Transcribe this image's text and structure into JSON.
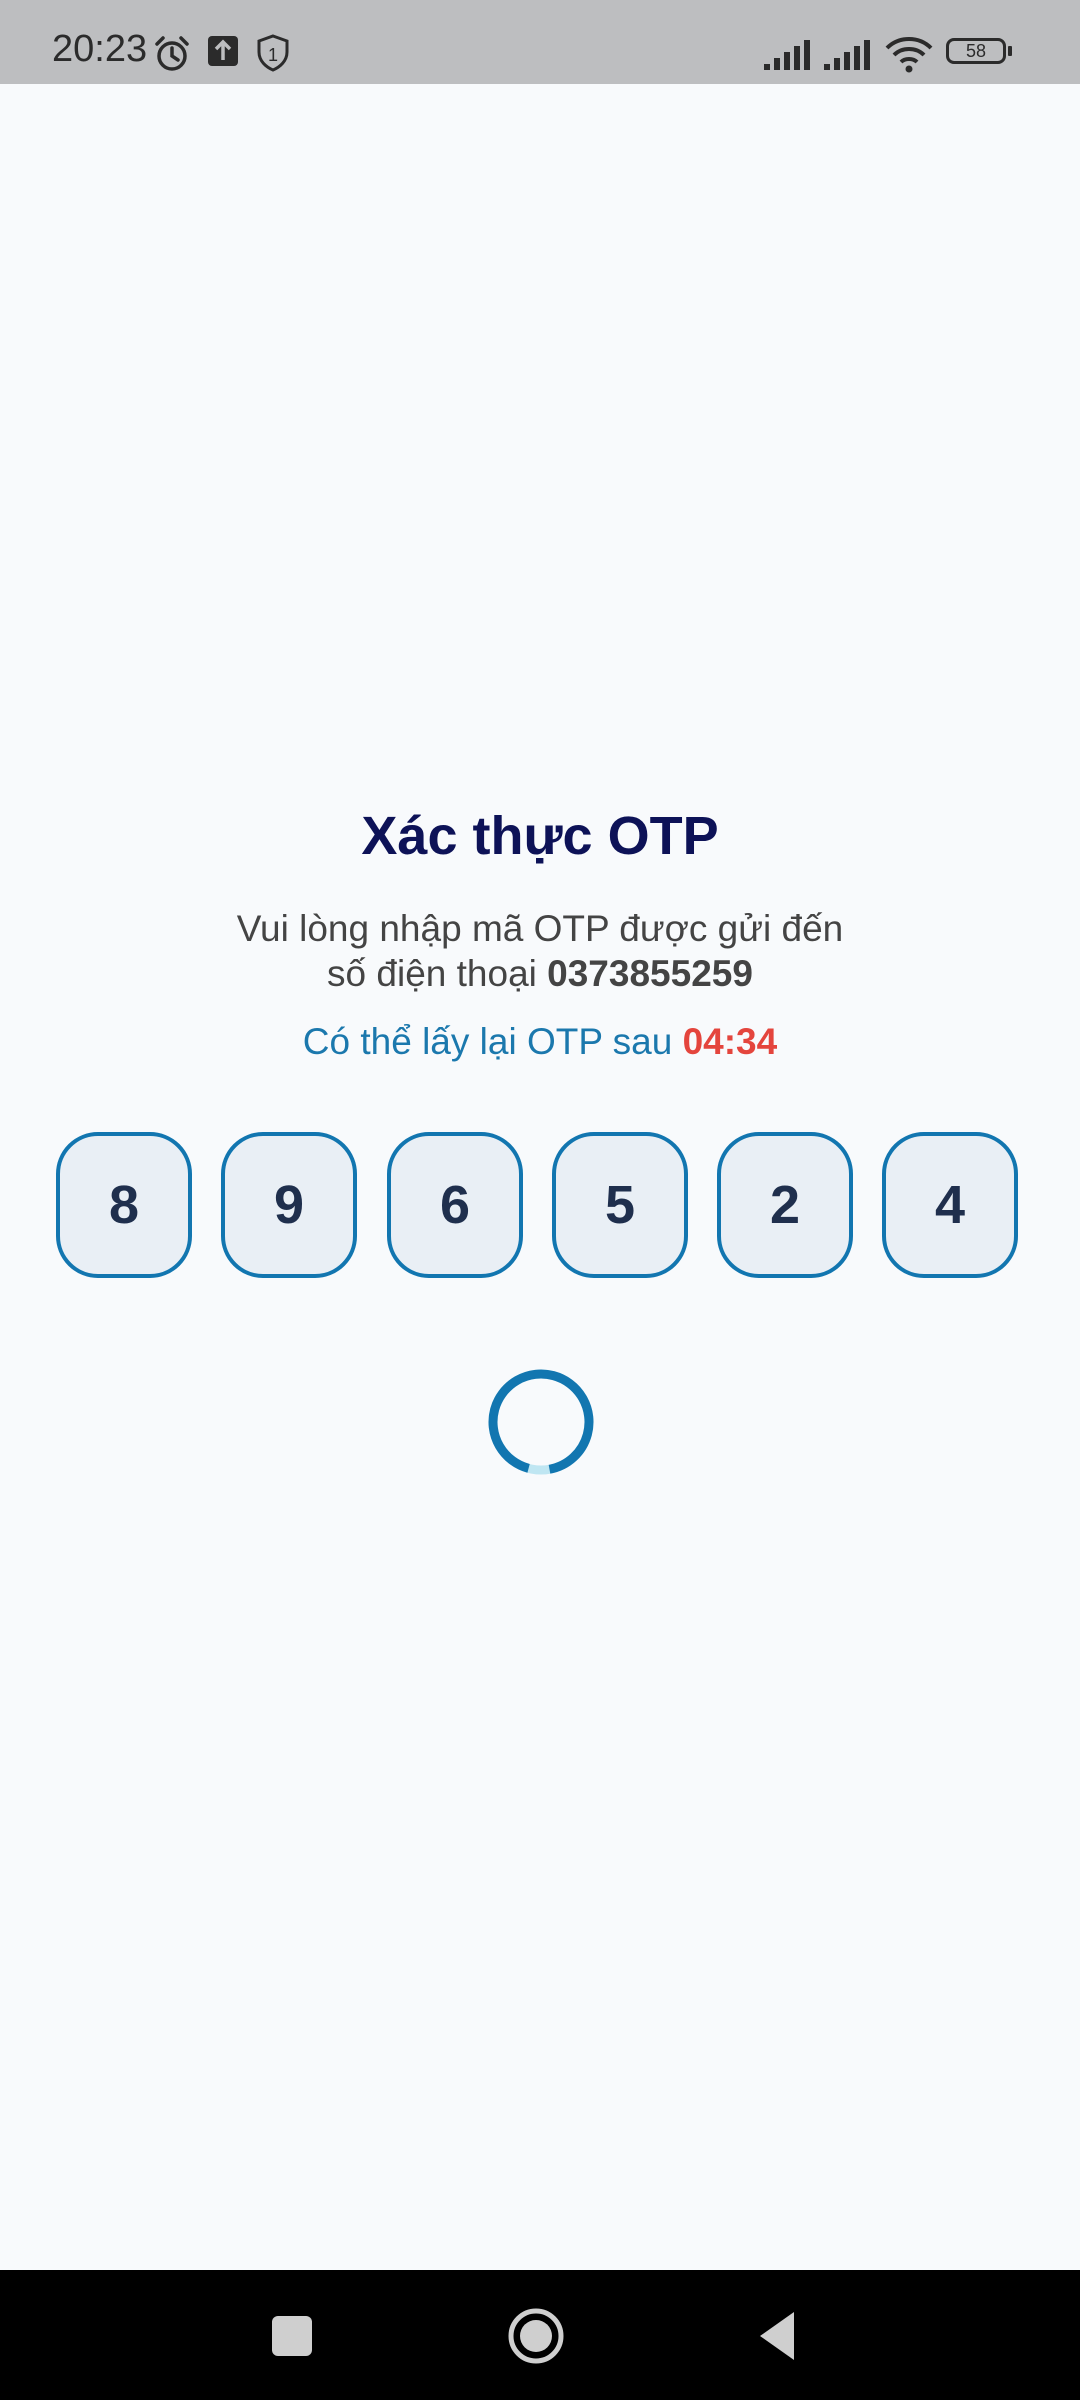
{
  "status_bar": {
    "time": "20:23",
    "battery": "58",
    "icons": [
      "alarm-icon",
      "upload-icon",
      "shield-icon",
      "signal-icon",
      "signal-icon",
      "wifi-icon",
      "battery-icon"
    ]
  },
  "otp": {
    "title": "Xác thực OTP",
    "description_line1": "Vui lòng nhập mã OTP được gửi đến",
    "description_line2_prefix": "số điện thoại ",
    "phone": "0373855259",
    "resend_prefix": "Có thể lấy lại OTP sau ",
    "timer": "04:34",
    "digits": [
      "8",
      "9",
      "6",
      "5",
      "2",
      "4"
    ]
  },
  "colors": {
    "title": "#0d1257",
    "accent": "#1276b0",
    "timer": "#e4453d",
    "box_fill": "#e9eff5"
  },
  "nav": {
    "icons": [
      "recents-icon",
      "home-icon",
      "back-icon"
    ]
  }
}
